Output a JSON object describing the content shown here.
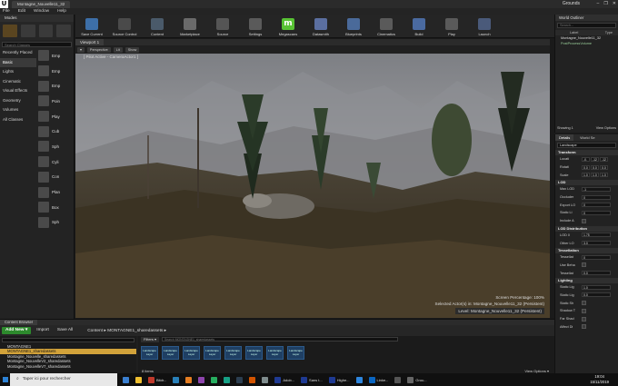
{
  "titlebar": {
    "tab": "Montagne_Nouvelle11_32",
    "project": "Grounds",
    "min": "–",
    "max": "❐",
    "close": "✕"
  },
  "menu": [
    "File",
    "Edit",
    "Window",
    "Help"
  ],
  "modes": {
    "title": "Modes",
    "search_placeholder": "Search Classes",
    "categories": [
      "Recently Placed",
      "Basic",
      "Lights",
      "Cinematic",
      "Visual Effects",
      "Geometry",
      "Volumes",
      "All Classes"
    ],
    "selected_category": 1,
    "items": [
      "Emp",
      "Emp",
      "Emp",
      "Poin",
      "Play",
      "Cub",
      "Sph",
      "Cyli",
      "Con",
      "Plan",
      "Box",
      "Sph"
    ]
  },
  "toolbar": [
    {
      "label": "Save Current",
      "color": "#3d6fa8"
    },
    {
      "label": "Source Control",
      "color": "#4a4a4a"
    },
    {
      "label": "Content",
      "color": "#4a5a6a"
    },
    {
      "label": "Marketplace",
      "color": "#6a6a6a"
    },
    {
      "label": "Source",
      "color": "#555"
    },
    {
      "label": "Settings",
      "color": "#5a5a5a"
    },
    {
      "label": "Megascans",
      "color": "#58c234"
    },
    {
      "label": "Datasmith",
      "color": "#5b6fa0"
    },
    {
      "label": "Blueprints",
      "color": "#4a6a9a"
    },
    {
      "label": "Cinematics",
      "color": "#5a5a5a"
    },
    {
      "label": "Build",
      "color": "#4a6aa0"
    },
    {
      "label": "Play",
      "color": "#5a5a5a"
    },
    {
      "label": "Launch",
      "color": "#4a5a7a"
    }
  ],
  "viewport": {
    "tab": "Viewport 1",
    "bar": [
      "▾",
      "Perspective",
      "Lit",
      "Show"
    ],
    "pilot_label": "[ Pilot Active - CameraActor1 ]",
    "screen_percentage_label": "Screen Percentage:",
    "screen_percentage": "100%",
    "selected_actor_label": "Selected Actor(s) in:",
    "selected_actor_level": "Montagne_Nouvelle11_32 (Persistent)",
    "level_label": "Level:",
    "level": "Montagne_Nouvelle11_32 (Persistent)"
  },
  "outliner": {
    "title": "World Outliner",
    "search_placeholder": "Search...",
    "col_label": "Label",
    "col_type": "Type",
    "rows": [
      "Montagne_Nouvelle11_32",
      "PostProcessVolume"
    ],
    "showing": "Showing 1",
    "view_options": "View Options"
  },
  "details": {
    "tab_details": "Details",
    "tab_world": "World Se",
    "name": "Landscape",
    "sections": {
      "transform": "Transform",
      "lod": "LOD",
      "lod_dist": "LOD Distribution",
      "tess": "Tessellation",
      "lighting": "Lighting"
    },
    "transform": [
      {
        "label": "Locati",
        "values": [
          "-0.",
          "-12",
          "-12"
        ]
      },
      {
        "label": "Rotati",
        "values": [
          "0.0",
          "0.0",
          "0.0"
        ]
      },
      {
        "label": "Scale",
        "values": [
          "1.0",
          "1.0",
          "1.0"
        ]
      }
    ],
    "lod": [
      {
        "label": "Max LOD",
        "value": "-1"
      },
      {
        "label": "Occluder",
        "value": "0"
      },
      {
        "label": "Export LO",
        "value": "0"
      },
      {
        "label": "Static Li",
        "value": "0"
      },
      {
        "label": "Include A",
        "value": ""
      }
    ],
    "lod_distribution": [
      {
        "label": "LOD 0",
        "value": "1.75"
      },
      {
        "label": "Other LO",
        "value": "3.0"
      }
    ],
    "tessellation": [
      {
        "label": "Tessellat",
        "value": "0"
      },
      {
        "label": "Use Beha",
        "value": ""
      },
      {
        "label": "Tessellat",
        "value": "0.0"
      }
    ],
    "lighting": [
      {
        "label": "Static Lig",
        "value": "1.0"
      },
      {
        "label": "Static Lig",
        "value": "0.0"
      },
      {
        "label": "Static Sh",
        "value": ""
      },
      {
        "label": "Shadow T",
        "value": ""
      },
      {
        "label": "Far Shad",
        "value": ""
      },
      {
        "label": "Affect Di",
        "value": ""
      }
    ]
  },
  "content_browser": {
    "tab": "Content Browser",
    "add_new": "Add New ▾",
    "import": "Import",
    "save_all": "Save All",
    "crumb": "Content  ▸  MONTAGNE1_sharedassets  ▸",
    "tree": [
      "MONTAGNE1",
      "MONTAGNE1_sharedassets",
      "Montagne_Nouvelle_sharedassets",
      "Montagne_NouvelleV2_sharedassets",
      "Montagne_NouvelleV7_sharedassets"
    ],
    "tree_selected": 1,
    "filters": "Filters ▾",
    "search_placeholder": "Search MONTAGNE1_sharedassets",
    "assets": [
      "Landscape Layer",
      "Landscape Layer",
      "Landscape Layer",
      "Landscape Layer",
      "Landscape Layer",
      "Landscape Layer",
      "Landscape Layer",
      "Landscape Layer"
    ],
    "count": "8 items",
    "view_options": "View Options ▾"
  },
  "taskbar": {
    "search": "Taper ici pour rechercher",
    "apps": [
      {
        "label": "",
        "color": "#3a7fd0"
      },
      {
        "label": "",
        "color": "#f0c030"
      },
      {
        "label": "Bitdr...",
        "color": "#c0392b"
      },
      {
        "label": "",
        "color": "#2980b9"
      },
      {
        "label": "",
        "color": "#e67e22"
      },
      {
        "label": "",
        "color": "#8e44ad"
      },
      {
        "label": "",
        "color": "#27ae60"
      },
      {
        "label": "",
        "color": "#16a085"
      },
      {
        "label": "",
        "color": "#2c3e50"
      },
      {
        "label": "",
        "color": "#d35400"
      },
      {
        "label": "",
        "color": "#7f8c8d"
      },
      {
        "label": "Adob...",
        "color": "#1f3a93"
      },
      {
        "label": "Sans t...",
        "color": "#1f3a93"
      },
      {
        "label": "Highe...",
        "color": "#1f3a93"
      },
      {
        "label": "",
        "color": "#2e86de"
      },
      {
        "label": "Linke...",
        "color": "#0a66c2"
      },
      {
        "label": "",
        "color": "#555"
      },
      {
        "label": "Grou...",
        "color": "#666"
      }
    ],
    "time": "19:04",
    "date": "15/11/2019"
  }
}
